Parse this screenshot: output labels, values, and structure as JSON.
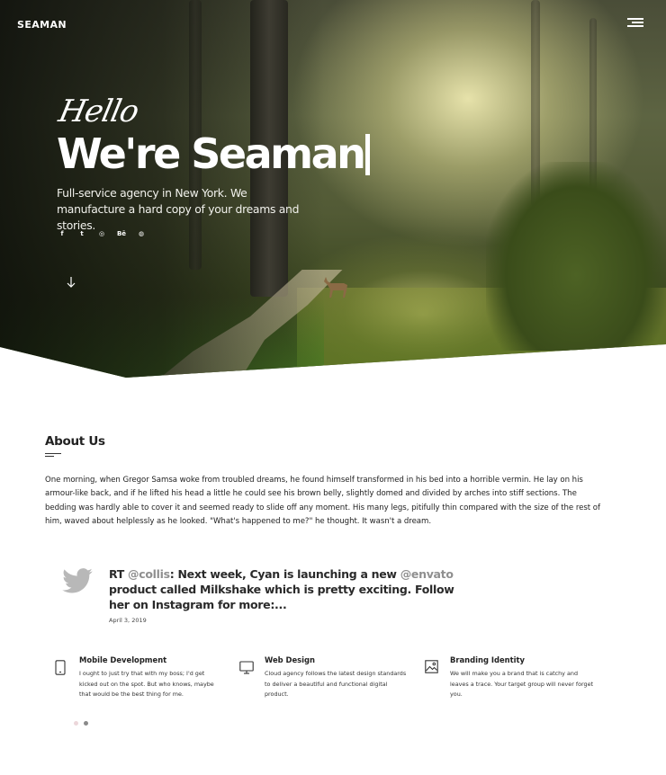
{
  "brand": {
    "logo": "SEAMAN"
  },
  "hero": {
    "script_greeting": "Hello",
    "headline": "We're Seaman",
    "tagline": "Full-service agency in New York. We manufacture a hard copy of your dreams and stories.",
    "social_icons": [
      "facebook-icon",
      "twitter-icon",
      "instagram-icon",
      "behance-icon",
      "dribbble-icon"
    ],
    "social_glyphs": [
      "f",
      "t",
      "◎",
      "Bē",
      "◍"
    ]
  },
  "about": {
    "title": "About Us",
    "text": "One morning, when Gregor Samsa woke from troubled dreams, he found himself transformed in his bed into a horrible vermin. He lay on his armour-like back, and if he lifted his head a little he could see his brown belly, slightly domed and divided by arches into stiff sections. The bedding was hardly able to cover it and seemed ready to slide off any moment. His many legs, pitifully thin compared with the size of the rest of him, waved about helplessly as he looked. \"What's happened to me?\" he thought. It wasn't a dream."
  },
  "tweet": {
    "prefix": "RT ",
    "mention1": "@collis",
    "part1": ": Next week, Cyan is launching a new ",
    "mention2": "@envato",
    "part2": " product called Milkshake which is pretty exciting. Follow her on Instagram for more:...",
    "date": "April 3, 2019"
  },
  "services": [
    {
      "icon": "mobile-phone-icon",
      "title": "Mobile Development",
      "desc": "I ought to just try that with my boss; I'd get kicked out on the spot. But who knows, maybe that would be the best thing for me."
    },
    {
      "icon": "monitor-icon",
      "title": "Web Design",
      "desc": "Cloud agency follows the latest design standards to deliver a beautiful and functional digital product."
    },
    {
      "icon": "image-icon",
      "title": "Branding Identity",
      "desc": "We will make you a brand that is catchy and leaves a trace. Your target group will never forget you."
    }
  ],
  "colors": {
    "mention": "#8f8f8f",
    "text": "#222222",
    "accent_dot": "#8a8a8a"
  }
}
